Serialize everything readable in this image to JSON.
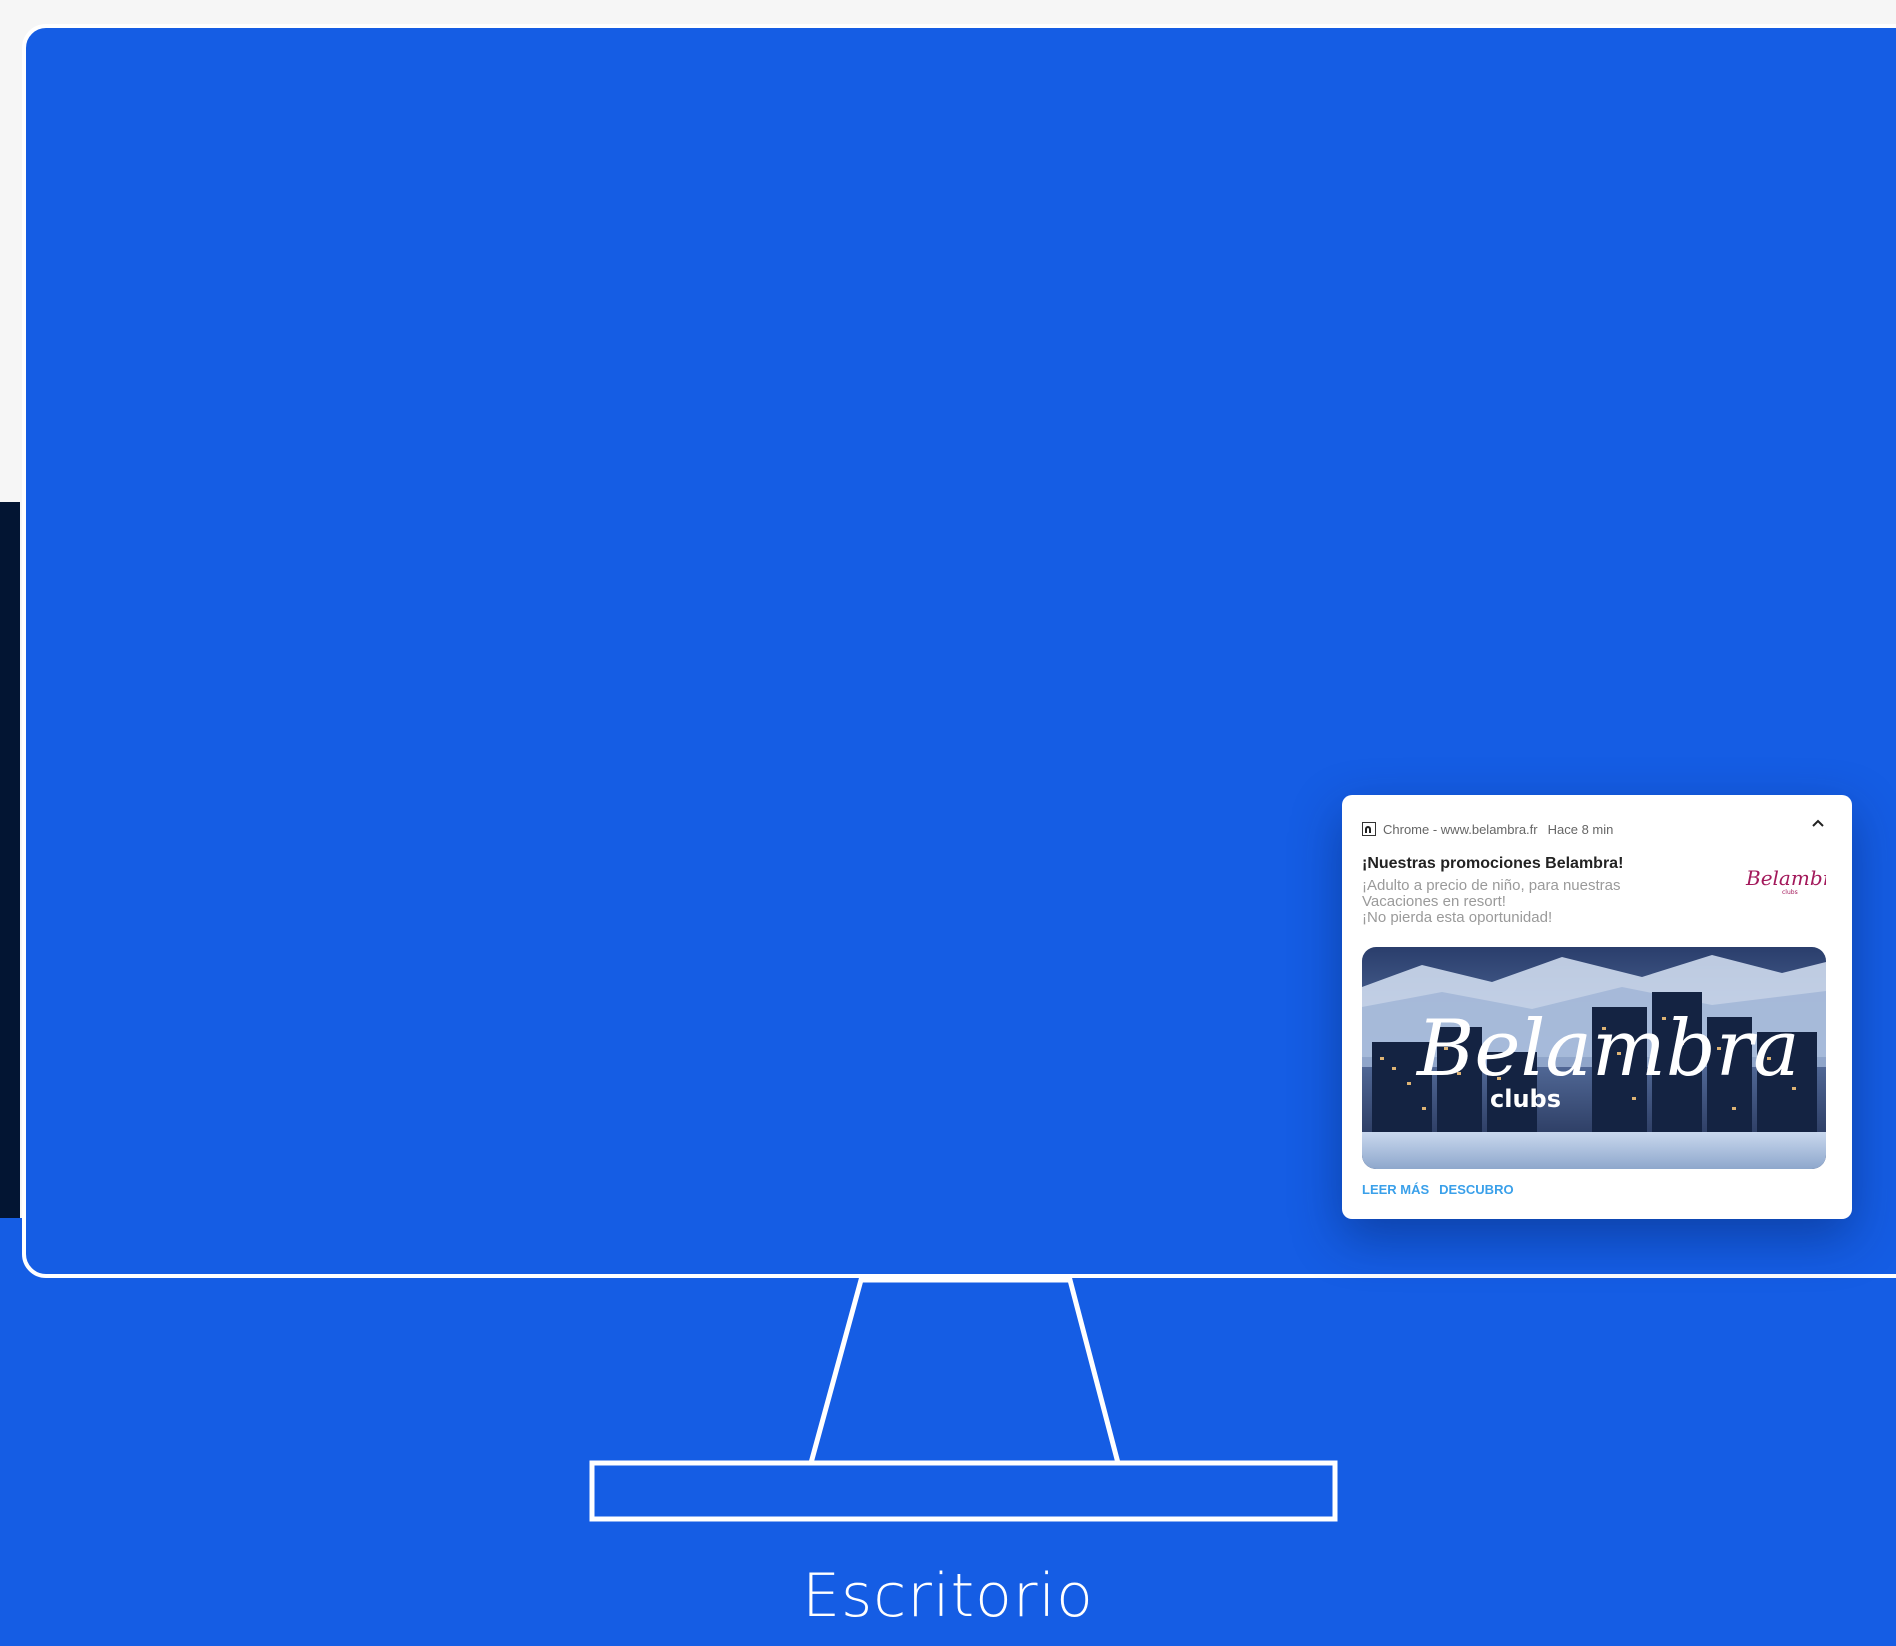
{
  "colors": {
    "accent": "#155de4",
    "dark_strip": "#031533",
    "link": "#3aa0ea",
    "logo_magenta": "#a3195b"
  },
  "notification": {
    "app_icon": "notification-app-icon",
    "source": "Chrome - www.belambra.fr",
    "time": "Hace 8 min",
    "collapse_icon": "chevron-up-icon",
    "title": "¡Nuestras promociones Belambra!",
    "body_lines": [
      "¡Adulto a precio de niño, para nuestras",
      "Vacaciones en resort!",
      "¡No pierda esta oportunidad!"
    ],
    "logo": {
      "brand": "Belambra",
      "sub": "clubs"
    },
    "image": {
      "brand": "Belambra",
      "sub": "clubs"
    },
    "actions": [
      "LEER MÁS",
      "DESCUBRO"
    ]
  },
  "caption": "Escritorio"
}
